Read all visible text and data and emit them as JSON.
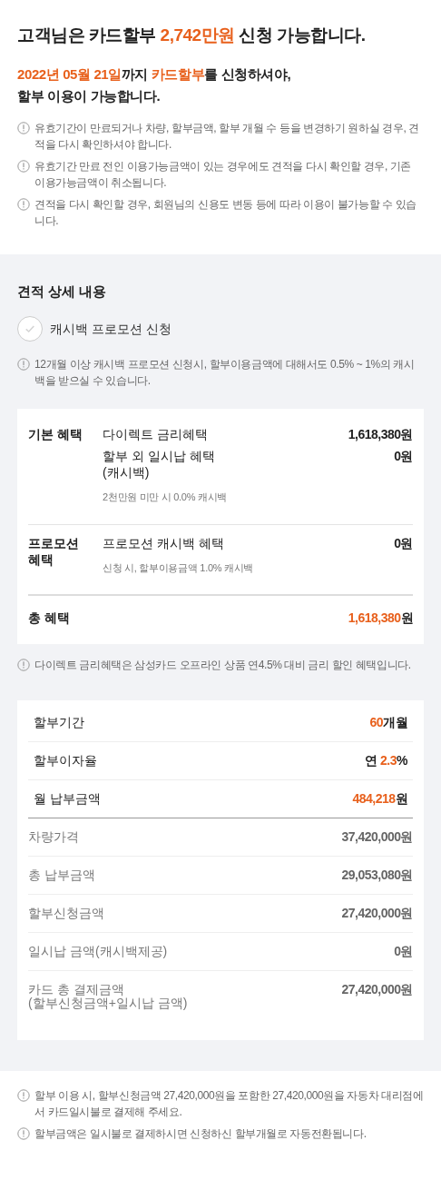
{
  "headline": [
    {
      "text": "고객님은 카드할부 ",
      "highlight": false
    },
    {
      "text": "2,742만원",
      "highlight": true
    },
    {
      "text": " 신청 가능합니다.",
      "highlight": false
    }
  ],
  "deadline": [
    {
      "text": "2022년 05월 21일",
      "highlight": true
    },
    {
      "text": "까지 ",
      "highlight": false
    },
    {
      "text": "카드할부",
      "highlight": true
    },
    {
      "text": "를 신청하셔야,\n할부 이용이 가능합니다.",
      "highlight": false
    }
  ],
  "notices": [
    "유효기간이 만료되거나 차량, 할부금액, 할부 개월 수 등을 변경하기 원하실 경우, 견적을 다시 확인하셔야 합니다.",
    "유효기간 만료 전인 이용가능금액이 있는 경우에도 견적을 다시 확인할 경우, 기존 이용가능금액이 취소됩니다.",
    "견적을 다시 확인할 경우, 회원님의 신용도 변동 등에 따라 이용이 불가능할 수 있습니다."
  ],
  "details": {
    "title": "견적 상세 내용",
    "promotion_checkbox": {
      "label": "캐시백 프로모션 신청",
      "checked": false
    },
    "promotion_notice": "12개월 이상 캐시백 프로모션 신청시, 할부이용금액에 대해서도 0.5% ~ 1%의 캐시백을 받으실 수 있습니다.",
    "benefits": [
      {
        "group": "기본 혜택",
        "items": [
          {
            "name": "다이렉트 금리혜택",
            "value": "1,618,380원"
          },
          {
            "name": "할부 외 일시납 혜택\n(캐시백)",
            "note": "2천만원 미만 시 0.0% 캐시백",
            "value": "0원"
          }
        ]
      },
      {
        "group": "프로모션\n혜택",
        "items": [
          {
            "name": "프로모션 캐시백 혜택",
            "note": "신청 시, 할부이용금액 1.0% 캐시백",
            "value": "0원"
          }
        ]
      }
    ],
    "total": {
      "label": "총 혜택",
      "amount": "1,618,380",
      "unit": "원"
    },
    "benefit_notice": "다이렉트 금리혜택은 삼성카드 오프라인 상품 연4.5% 대비 금리 할인 혜택입니다.",
    "summary": [
      {
        "kind": "primary",
        "label": "할부기간",
        "value": [
          {
            "text": "60",
            "highlight": true
          },
          {
            "text": "개월",
            "highlight": false
          }
        ]
      },
      {
        "kind": "primary",
        "label": "할부이자율",
        "value": [
          {
            "text": "연 ",
            "highlight": false
          },
          {
            "text": "2.3",
            "highlight": true
          },
          {
            "text": "%",
            "highlight": false
          }
        ]
      },
      {
        "kind": "primary",
        "label": "월 납부금액",
        "value": [
          {
            "text": "484,218",
            "highlight": true
          },
          {
            "text": "원",
            "highlight": false
          }
        ]
      },
      {
        "kind": "secondary",
        "label": "차량가격",
        "value": [
          {
            "text": "37,420,000원",
            "highlight": false
          }
        ]
      },
      {
        "kind": "secondary",
        "label": "총 납부금액",
        "value": [
          {
            "text": "29,053,080원",
            "highlight": false
          }
        ]
      },
      {
        "kind": "secondary",
        "label": "할부신청금액",
        "value": [
          {
            "text": "27,420,000원",
            "highlight": false
          }
        ]
      },
      {
        "kind": "secondary",
        "label": "일시납 금액(캐시백제공)",
        "value": [
          {
            "text": "0원",
            "highlight": false
          }
        ]
      },
      {
        "kind": "secondary",
        "label": "카드 총 결제금액\n(할부신청금액+일시납 금액)",
        "value": [
          {
            "text": "27,420,000원",
            "highlight": false
          }
        ]
      }
    ]
  },
  "footer_notices": [
    "할부 이용 시, 할부신청금액 27,420,000원을 포함한 27,420,000원을 자동차 대리점에서 카드일시불로 결제해 주세요.",
    "할부금액은 일시불로 결제하시면 신청하신 할부개월로 자동전환됩니다."
  ]
}
